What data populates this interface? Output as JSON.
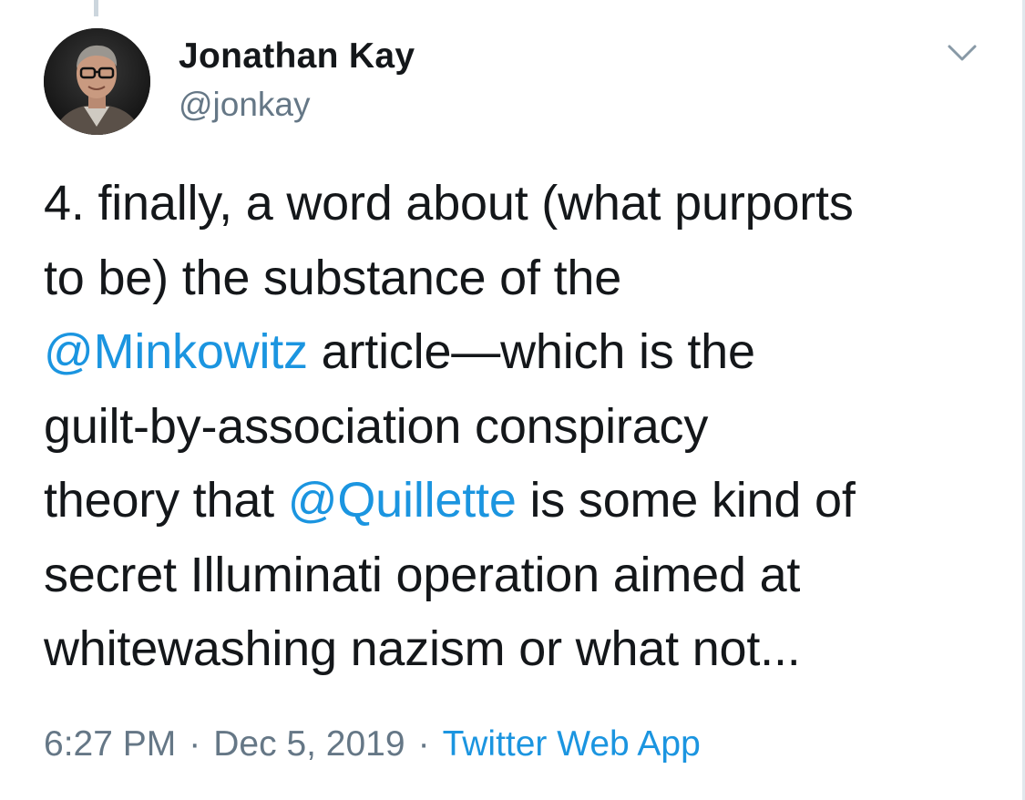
{
  "author": {
    "name": "Jonathan Kay",
    "handle": "@jonkay",
    "avatar_icon": "profile-photo"
  },
  "menu": {
    "icon": "chevron-down-icon"
  },
  "tweet": {
    "line1": "4. finally, a word about (what purports",
    "line2": "to be) the substance of the",
    "mention1": "@Minkowitz",
    "line3_rest": " article—which is the",
    "line4": "guilt-by-association conspiracy",
    "line5_start": "theory that ",
    "mention2": "@Quillette",
    "line5_rest": " is some kind of",
    "line6": "secret Illuminati operation aimed at",
    "line7": "whitewashing nazism or what not..."
  },
  "meta": {
    "time": "6:27 PM",
    "separator": "·",
    "date": "Dec 5, 2019",
    "source": "Twitter Web App"
  },
  "colors": {
    "link": "#1b95e0",
    "text": "#14171a",
    "secondary": "#657786"
  }
}
